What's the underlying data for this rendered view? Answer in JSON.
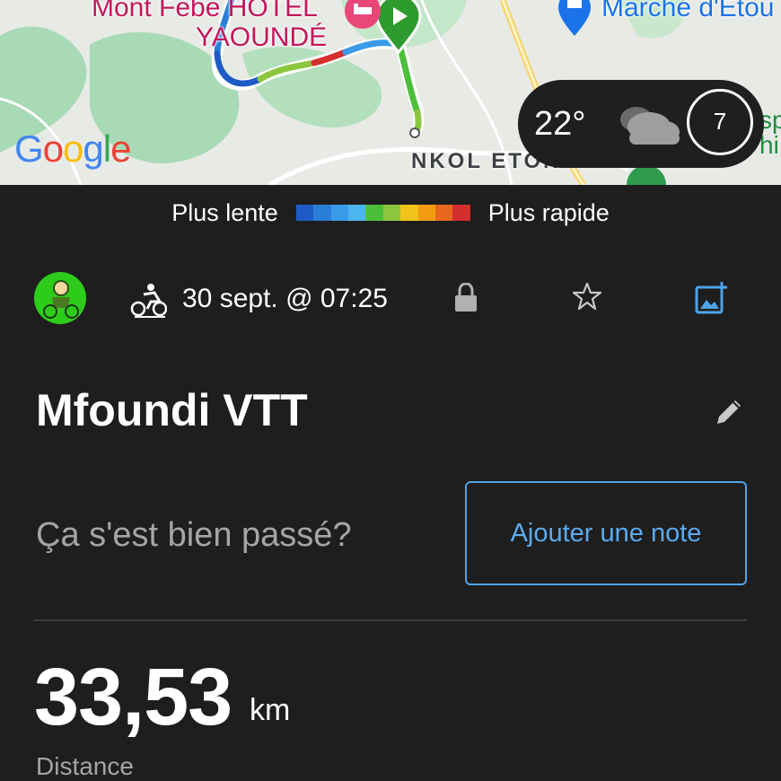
{
  "map": {
    "poi_hotel": "Mont Febe HOTEL",
    "poi_hotel_line2": "YAOUNDÉ",
    "poi_market": "Marché d'Etou",
    "district": "NKOL ETON",
    "google_logo": "Google",
    "side_text_1": "sp",
    "side_text_2": "hi",
    "weather": {
      "temperature": "22°",
      "icon": "cloud-icon",
      "moon_value": "7"
    }
  },
  "legend": {
    "slow_label": "Plus lente",
    "fast_label": "Plus rapide",
    "colors": [
      "#1e5bc6",
      "#2a7ed8",
      "#3a9be8",
      "#4bb5f0",
      "#4cbf3a",
      "#8cc63e",
      "#f0c419",
      "#f39c12",
      "#e8671c",
      "#d32f2f"
    ]
  },
  "activity": {
    "avatar": "user-avatar",
    "type_icon": "cycling-icon",
    "datetime": "30 sept. @ 07:25",
    "title": "Mfoundi VTT",
    "question": "Ça s'est bien passé?",
    "add_note_label": "Ajouter une note",
    "distance": {
      "value": "33,53",
      "unit": "km",
      "label": "Distance"
    }
  },
  "colors": {
    "background": "#1e1e1e",
    "accent": "#4ea3e8",
    "pin_green": "#2e9b2e"
  }
}
